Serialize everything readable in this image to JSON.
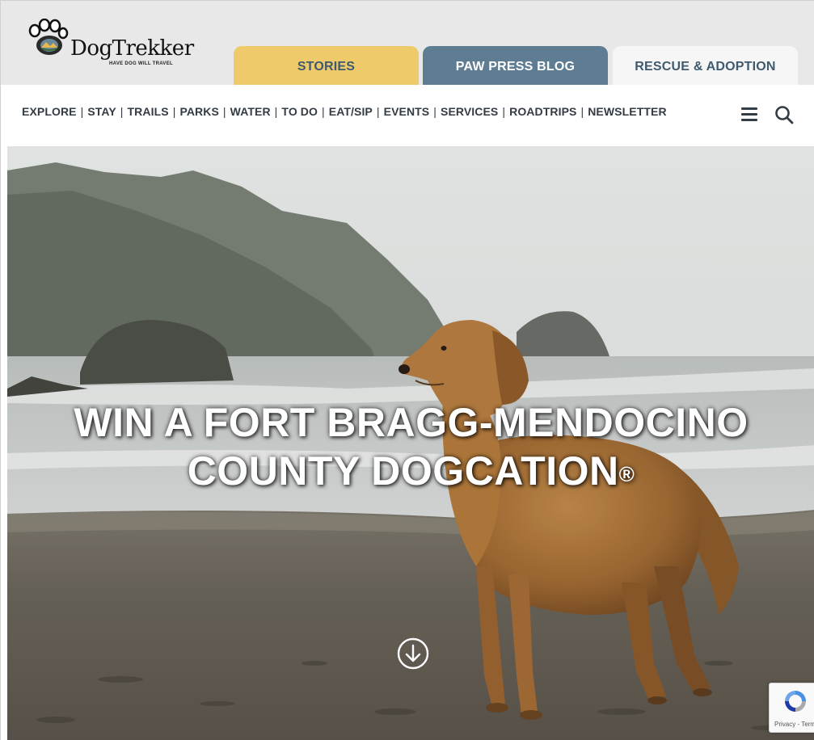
{
  "brand": {
    "name": "DogTrekker",
    "tagline": "HAVE DOG WILL TRAVEL"
  },
  "tabs": [
    {
      "label": "STORIES",
      "color": "#efca6b"
    },
    {
      "label": "PAW PRESS BLOG",
      "color": "#5f7d92"
    },
    {
      "label": "RESCUE & ADOPTION",
      "color": "#f6f6f6"
    }
  ],
  "nav": {
    "links": [
      "EXPLORE",
      "STAY",
      "TRAILS",
      "PARKS",
      "WATER",
      "TO DO",
      "EAT/SIP",
      "EVENTS",
      "SERVICES",
      "ROADTRIPS",
      "NEWSLETTER"
    ],
    "separator": "|",
    "menu_icon": "hamburger-menu-icon",
    "search_icon": "search-icon"
  },
  "hero": {
    "title_line1": "WIN A FORT BRAGG-MENDOCINO",
    "title_line2": "COUNTY DOGCATION",
    "title_mark": "®",
    "scroll_icon": "arrow-down-circle-icon"
  },
  "recaptcha": {
    "text": "Privacy - Terms"
  },
  "colors": {
    "header_bg": "#e8e8e8",
    "nav_text": "#333c44",
    "tab_text": "#3f5a6e"
  }
}
